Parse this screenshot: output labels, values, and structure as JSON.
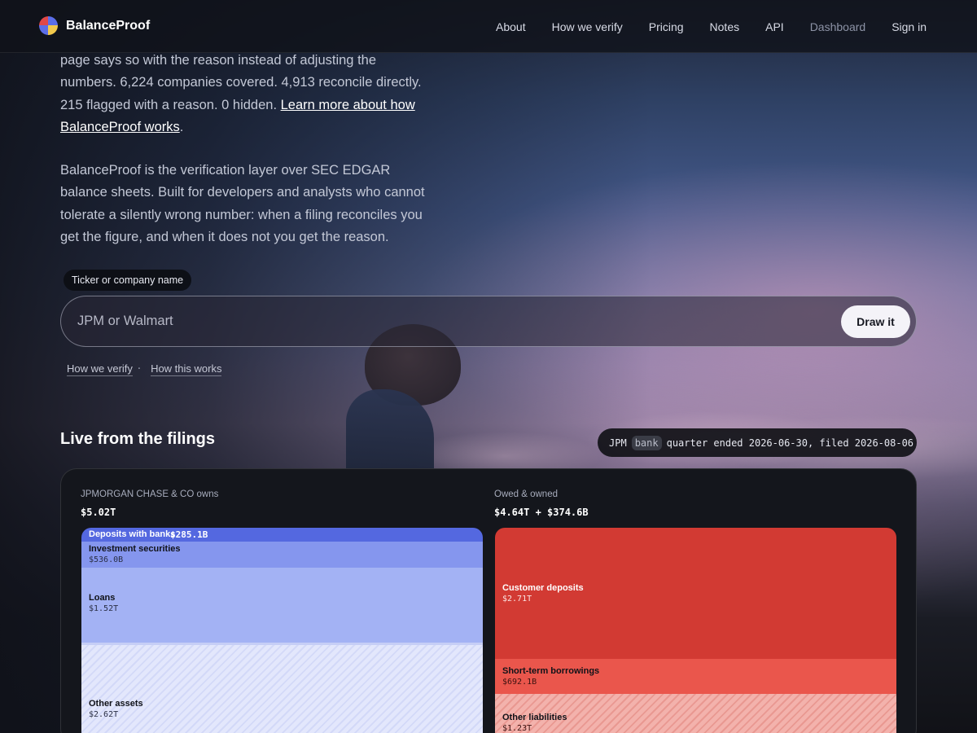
{
  "nav": {
    "brand": "BalanceProof",
    "links": [
      "About",
      "How we verify",
      "Pricing",
      "Notes",
      "API",
      "Dashboard"
    ],
    "sign_in": "Sign in"
  },
  "hero": {
    "para1_text": "page says so with the reason instead of adjusting the numbers. 6,224 companies covered. 4,913 reconcile directly. 215 flagged with a reason. 0 hidden.",
    "para1_link": "Learn more about how BalanceProof works",
    "para1_end": ".",
    "para2": "BalanceProof is the verification layer over SEC EDGAR balance sheets. Built for developers and analysts who cannot tolerate a silently wrong number: when a filing reconciles you get the figure, and when it does not you get the reason."
  },
  "search": {
    "label": "Ticker or company name",
    "placeholder": "JPM or Walmart",
    "button": "Draw it",
    "help_links": [
      "How we verify",
      "How this works"
    ],
    "separator": "·"
  },
  "live": {
    "title": "Live from the filings",
    "ticker": "JPM",
    "tag": "bank",
    "filing_text": "quarter ended 2026-06-30, filed 2026-08-06"
  },
  "balance_sheet": {
    "left": {
      "heading": "JPMORGAN CHASE & CO owns",
      "total": "$5.02T",
      "blocks": [
        {
          "label": "Deposits with banks",
          "value": "$285.1B",
          "color": "#5468e0"
        },
        {
          "label": "Investment securities",
          "value": "$536.0B",
          "color": "#8596ee"
        },
        {
          "label": "Loans",
          "value": "$1.52T",
          "color": "#a3b2f4"
        },
        {
          "label": "Other assets",
          "value": "$2.62T",
          "color": "#e0e5fb"
        }
      ]
    },
    "right": {
      "heading": "Owed & owned",
      "total": "$4.64T + $374.6B",
      "blocks": [
        {
          "label": "Customer deposits",
          "value": "$2.71T",
          "color": "#d23a33"
        },
        {
          "label": "Short-term borrowings",
          "value": "$692.1B",
          "color": "#ea564c"
        },
        {
          "label": "Other liabilities",
          "value": "$1.23T",
          "color": "#f1a9a3"
        }
      ]
    }
  }
}
